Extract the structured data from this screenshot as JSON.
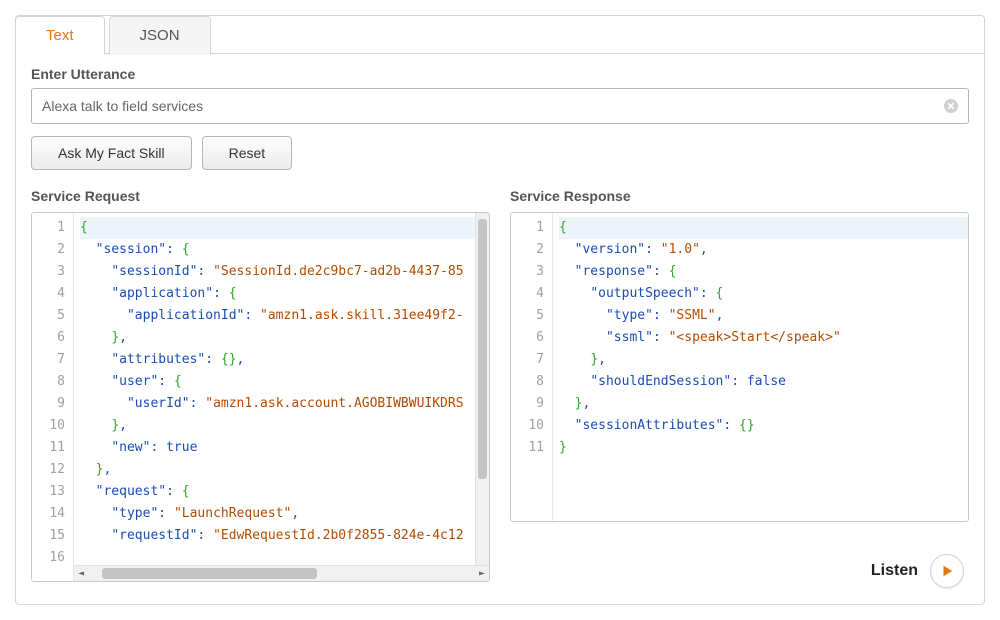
{
  "tabs": {
    "text": "Text",
    "json": "JSON"
  },
  "utterance": {
    "label": "Enter Utterance",
    "value": "Alexa talk to field services"
  },
  "buttons": {
    "ask": "Ask My Fact Skill",
    "reset": "Reset"
  },
  "request": {
    "header": "Service Request",
    "lines": [
      [
        [
          "brace",
          "{"
        ]
      ],
      [
        [
          "plain",
          "  "
        ],
        [
          "key",
          "\"session\""
        ],
        [
          "punc",
          ": "
        ],
        [
          "brace",
          "{"
        ]
      ],
      [
        [
          "plain",
          "    "
        ],
        [
          "key",
          "\"sessionId\""
        ],
        [
          "punc",
          ": "
        ],
        [
          "str",
          "\"SessionId.de2c9bc7-ad2b-4437-85"
        ]
      ],
      [
        [
          "plain",
          "    "
        ],
        [
          "key",
          "\"application\""
        ],
        [
          "punc",
          ": "
        ],
        [
          "brace",
          "{"
        ]
      ],
      [
        [
          "plain",
          "      "
        ],
        [
          "key",
          "\"applicationId\""
        ],
        [
          "punc",
          ": "
        ],
        [
          "str",
          "\"amzn1.ask.skill.31ee49f2-"
        ]
      ],
      [
        [
          "plain",
          "    "
        ],
        [
          "brace",
          "}"
        ],
        [
          "punc",
          ","
        ]
      ],
      [
        [
          "plain",
          "    "
        ],
        [
          "key",
          "\"attributes\""
        ],
        [
          "punc",
          ": "
        ],
        [
          "brace",
          "{}"
        ],
        [
          "punc",
          ","
        ]
      ],
      [
        [
          "plain",
          "    "
        ],
        [
          "key",
          "\"user\""
        ],
        [
          "punc",
          ": "
        ],
        [
          "brace",
          "{"
        ]
      ],
      [
        [
          "plain",
          "      "
        ],
        [
          "key",
          "\"userId\""
        ],
        [
          "punc",
          ": "
        ],
        [
          "str",
          "\"amzn1.ask.account.AGOBIWBWUIKDRS"
        ]
      ],
      [
        [
          "plain",
          "    "
        ],
        [
          "brace",
          "}"
        ],
        [
          "punc",
          ","
        ]
      ],
      [
        [
          "plain",
          "    "
        ],
        [
          "key",
          "\"new\""
        ],
        [
          "punc",
          ": "
        ],
        [
          "bool",
          "true"
        ]
      ],
      [
        [
          "plain",
          "  "
        ],
        [
          "brace",
          "}"
        ],
        [
          "punc",
          ","
        ]
      ],
      [
        [
          "plain",
          "  "
        ],
        [
          "key",
          "\"request\""
        ],
        [
          "punc",
          ": "
        ],
        [
          "brace",
          "{"
        ]
      ],
      [
        [
          "plain",
          "    "
        ],
        [
          "key",
          "\"type\""
        ],
        [
          "punc",
          ": "
        ],
        [
          "str",
          "\"LaunchRequest\""
        ],
        [
          "punc",
          ","
        ]
      ],
      [
        [
          "plain",
          "    "
        ],
        [
          "key",
          "\"requestId\""
        ],
        [
          "punc",
          ": "
        ],
        [
          "str",
          "\"EdwRequestId.2b0f2855-824e-4c12"
        ]
      ],
      [
        [
          "plain",
          ""
        ]
      ]
    ]
  },
  "response": {
    "header": "Service Response",
    "lines": [
      [
        [
          "brace",
          "{"
        ]
      ],
      [
        [
          "plain",
          "  "
        ],
        [
          "key",
          "\"version\""
        ],
        [
          "punc",
          ": "
        ],
        [
          "str",
          "\"1.0\""
        ],
        [
          "punc",
          ","
        ]
      ],
      [
        [
          "plain",
          "  "
        ],
        [
          "key",
          "\"response\""
        ],
        [
          "punc",
          ": "
        ],
        [
          "brace",
          "{"
        ]
      ],
      [
        [
          "plain",
          "    "
        ],
        [
          "key",
          "\"outputSpeech\""
        ],
        [
          "punc",
          ": "
        ],
        [
          "brace",
          "{"
        ]
      ],
      [
        [
          "plain",
          "      "
        ],
        [
          "key",
          "\"type\""
        ],
        [
          "punc",
          ": "
        ],
        [
          "str",
          "\"SSML\""
        ],
        [
          "punc",
          ","
        ]
      ],
      [
        [
          "plain",
          "      "
        ],
        [
          "key",
          "\"ssml\""
        ],
        [
          "punc",
          ": "
        ],
        [
          "str",
          "\"<speak>Start</speak>\""
        ]
      ],
      [
        [
          "plain",
          "    "
        ],
        [
          "brace",
          "}"
        ],
        [
          "punc",
          ","
        ]
      ],
      [
        [
          "plain",
          "    "
        ],
        [
          "key",
          "\"shouldEndSession\""
        ],
        [
          "punc",
          ": "
        ],
        [
          "bool",
          "false"
        ]
      ],
      [
        [
          "plain",
          "  "
        ],
        [
          "brace",
          "}"
        ],
        [
          "punc",
          ","
        ]
      ],
      [
        [
          "plain",
          "  "
        ],
        [
          "key",
          "\"sessionAttributes\""
        ],
        [
          "punc",
          ": "
        ],
        [
          "brace",
          "{}"
        ]
      ],
      [
        [
          "brace",
          "}"
        ]
      ]
    ]
  },
  "listen": {
    "label": "Listen"
  }
}
